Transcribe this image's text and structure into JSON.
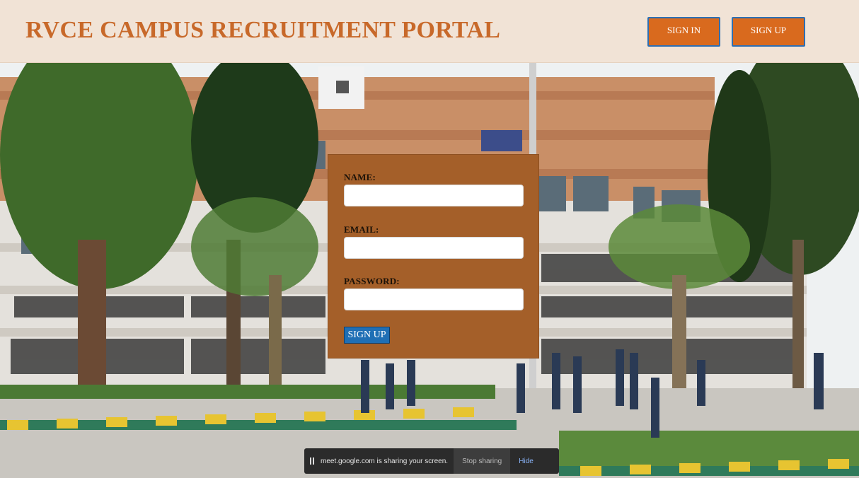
{
  "header": {
    "title": "RVCE CAMPUS RECRUITMENT PORTAL",
    "sign_in_label": "SIGN IN",
    "sign_up_label": "SIGN UP"
  },
  "form": {
    "name_label": "NAME:",
    "email_label": "EMAIL:",
    "password_label": "PASSWORD:",
    "name_value": "",
    "email_value": "",
    "password_value": "",
    "submit_label": "SIGN UP"
  },
  "share_bar": {
    "message": "meet.google.com is sharing your screen.",
    "stop_label": "Stop sharing",
    "hide_label": "Hide"
  },
  "colors": {
    "header_bg": "#f1e3d6",
    "title": "#c8692a",
    "header_button": "#d96a1e",
    "form_bg": "#a45f29",
    "submit_button": "#1f6fb5"
  }
}
